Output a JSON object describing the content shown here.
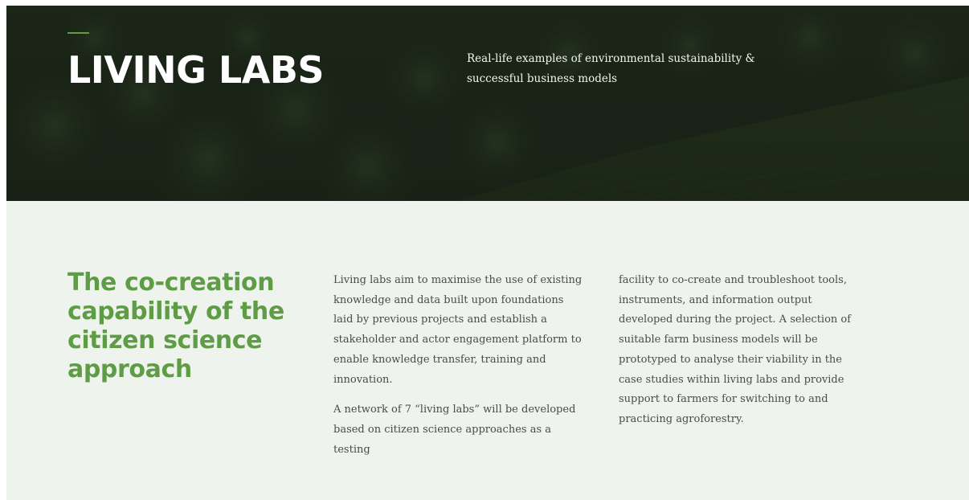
{
  "colors": {
    "hero_overlay": "#1c2619",
    "accent_green": "#5e9c46",
    "content_background": "#eff3ee",
    "hero_text": "#ffffff",
    "body_text": "#4a4a4a"
  },
  "hero": {
    "title": "LIVING LABS",
    "subtitle": "Real-life examples of environmental sustainability & successful business models",
    "background_image": "forest-and-field-landscape"
  },
  "section": {
    "heading": "The co-creation capability of the citizen science approach",
    "column_1": {
      "paragraph_1": "Living labs aim to maximise the use of existing knowledge and data built upon foundations laid by previous projects and establish a stakeholder and actor engagement platform to enable knowledge transfer, training and innovation.",
      "paragraph_2": "A network of 7 “living labs” will be developed based on citizen science approaches as a testing"
    },
    "column_2": {
      "paragraph_1": "facility to co-create and troubleshoot tools, instruments, and information output developed during the project. A selection of suitable farm business models will be prototyped to analyse their viability in the case studies within living labs and provide support to farmers for switching to and practicing agroforestry."
    }
  }
}
